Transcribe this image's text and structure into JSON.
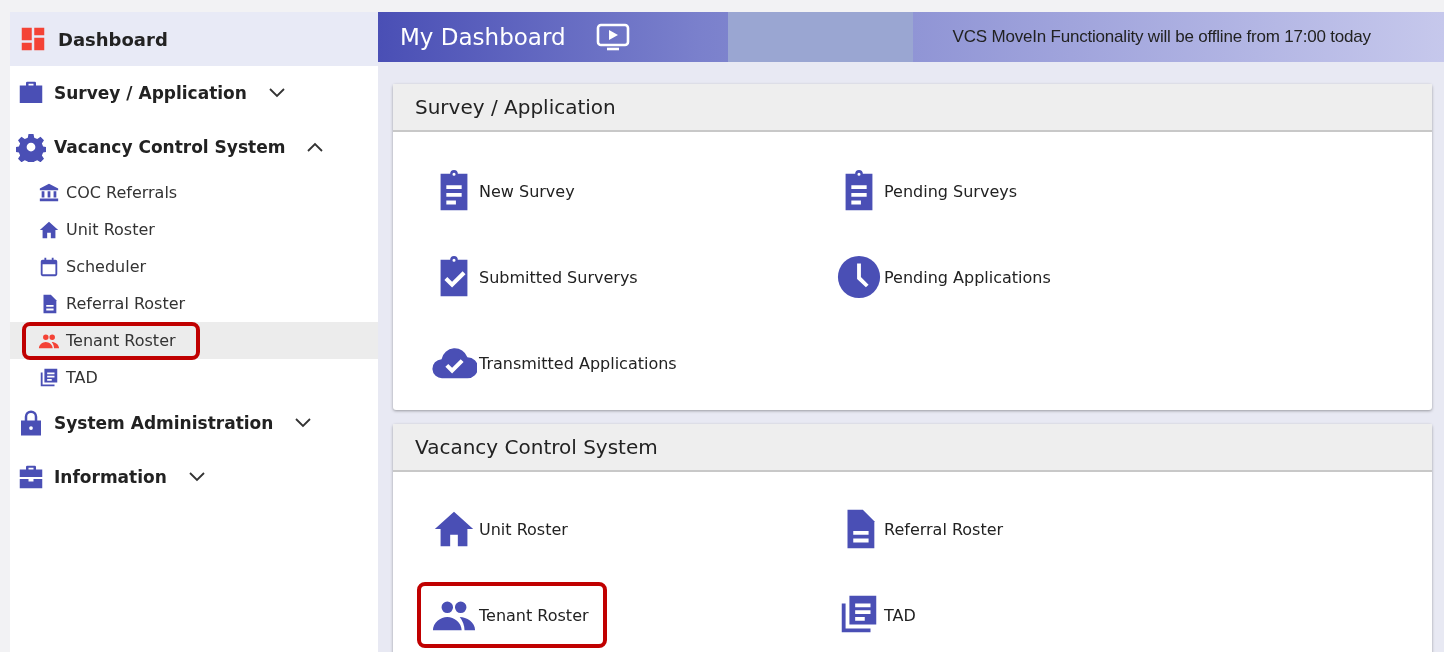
{
  "sidebar": {
    "home": {
      "label": "Dashboard",
      "kind": "grid",
      "selected": true
    },
    "groups": [
      {
        "label": "Survey / Application",
        "kind": "briefcase",
        "expanded": false
      },
      {
        "label": "Vacancy Control System",
        "kind": "gear",
        "expanded": true,
        "items": [
          {
            "label": "COC Referrals",
            "kind": "bank",
            "selected": false,
            "highlighted": false
          },
          {
            "label": "Unit Roster",
            "kind": "home",
            "selected": false,
            "highlighted": false
          },
          {
            "label": "Scheduler",
            "kind": "calendar",
            "selected": false,
            "highlighted": false
          },
          {
            "label": "Referral Roster",
            "kind": "document",
            "selected": false,
            "highlighted": false
          },
          {
            "label": "Tenant Roster",
            "kind": "people",
            "selected": true,
            "highlighted": true
          },
          {
            "label": "TAD",
            "kind": "stack",
            "selected": false,
            "highlighted": false
          }
        ]
      },
      {
        "label": "System Administration",
        "kind": "lock",
        "expanded": false
      },
      {
        "label": "Information",
        "kind": "toolbox",
        "expanded": false
      }
    ]
  },
  "header": {
    "title": "My Dashboard",
    "message": "VCS MoveIn Functionality will be offline from 17:00 today"
  },
  "panels": [
    {
      "title": "Survey / Application",
      "tiles": [
        {
          "label": "New Survey",
          "kind": "clipboard",
          "highlighted": false
        },
        {
          "label": "Pending Surveys",
          "kind": "clipboard",
          "highlighted": false
        },
        {
          "label": "Submitted Surverys",
          "kind": "clipboard-check",
          "highlighted": false
        },
        {
          "label": "Pending Applications",
          "kind": "clock",
          "highlighted": false
        },
        {
          "label": "Transmitted Applications",
          "kind": "cloud-check",
          "highlighted": false
        }
      ]
    },
    {
      "title": "Vacancy Control System",
      "tiles": [
        {
          "label": "Unit Roster",
          "kind": "home",
          "highlighted": false
        },
        {
          "label": "Referral Roster",
          "kind": "document",
          "highlighted": false
        },
        {
          "label": "Tenant Roster",
          "kind": "people",
          "highlighted": true
        },
        {
          "label": "TAD",
          "kind": "stack",
          "highlighted": false
        }
      ]
    }
  ]
}
